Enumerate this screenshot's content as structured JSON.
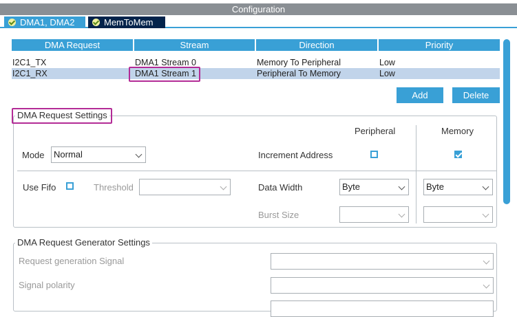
{
  "window": {
    "title": "Configuration"
  },
  "tabs": [
    {
      "label": "DMA1, DMA2"
    },
    {
      "label": "MemToMem"
    }
  ],
  "table": {
    "headers": [
      "DMA Request",
      "Stream",
      "Direction",
      "Priority"
    ],
    "rows": [
      {
        "request": "I2C1_TX",
        "stream": "DMA1 Stream 0",
        "direction": "Memory To Peripheral",
        "priority": "Low"
      },
      {
        "request": "I2C1_RX",
        "stream": "DMA1 Stream 1",
        "direction": "Peripheral To Memory",
        "priority": "Low"
      }
    ]
  },
  "buttons": {
    "add": "Add",
    "delete": "Delete"
  },
  "dma_settings": {
    "title": "DMA Request Settings",
    "peripheral_header": "Peripheral",
    "memory_header": "Memory",
    "mode_label": "Mode",
    "mode_value": "Normal",
    "increment_label": "Increment Address",
    "use_fifo_label": "Use Fifo",
    "threshold_label": "Threshold",
    "data_width_label": "Data Width",
    "peripheral_width": "Byte",
    "memory_width": "Byte",
    "burst_size_label": "Burst Size"
  },
  "generator": {
    "title": "DMA Request Generator Settings",
    "request_signal_label": "Request generation Signal",
    "signal_polarity_label": "Signal polarity"
  }
}
